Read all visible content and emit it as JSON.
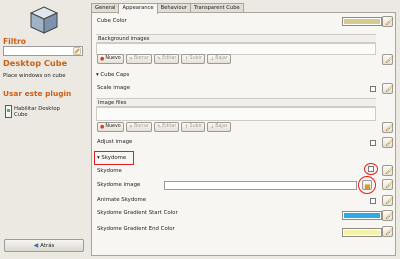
{
  "sidebar": {
    "filter_heading": "Filtro",
    "filter_value": "",
    "plugin_title": "Desktop Cube",
    "plugin_description": "Place windows on cube",
    "use_plugin_heading": "Usar este plugin",
    "enable_label": "Habilitar Desktop Cube",
    "back_label": "Atrás"
  },
  "tabs": [
    "General",
    "Appearance",
    "Behaviour",
    "Transparent Cube"
  ],
  "active_tab": "Appearance",
  "panel": {
    "cube_color_label": "Cube Color",
    "cube_color": "#d6cb8a",
    "background_images_header": "Background images",
    "buttons_bg": {
      "new": "Nuevo",
      "delete": "Borrar",
      "edit": "Editar",
      "up": "Subir",
      "down": "Bajar"
    },
    "cube_caps_label": "Cube Caps",
    "scale_image_label": "Scale image",
    "image_files_header": "Image files",
    "buttons_caps": {
      "new": "Nuevo",
      "delete": "Borrar",
      "edit": "Editar",
      "up": "Subir",
      "down": "Bajar"
    },
    "adjust_image_label": "Adjust image",
    "skydome_section_label": "Skydome",
    "skydome_label": "Skydome",
    "skydome_image_label": "Skydome image",
    "skydome_image_value": "",
    "animate_skydome_label": "Animate Skydome",
    "gradient_start_label": "Skydome Gradient Start Color",
    "gradient_start_color": "#2fa8e6",
    "gradient_end_label": "Skydome Gradient End Color",
    "gradient_end_color": "#f3f2a8"
  }
}
